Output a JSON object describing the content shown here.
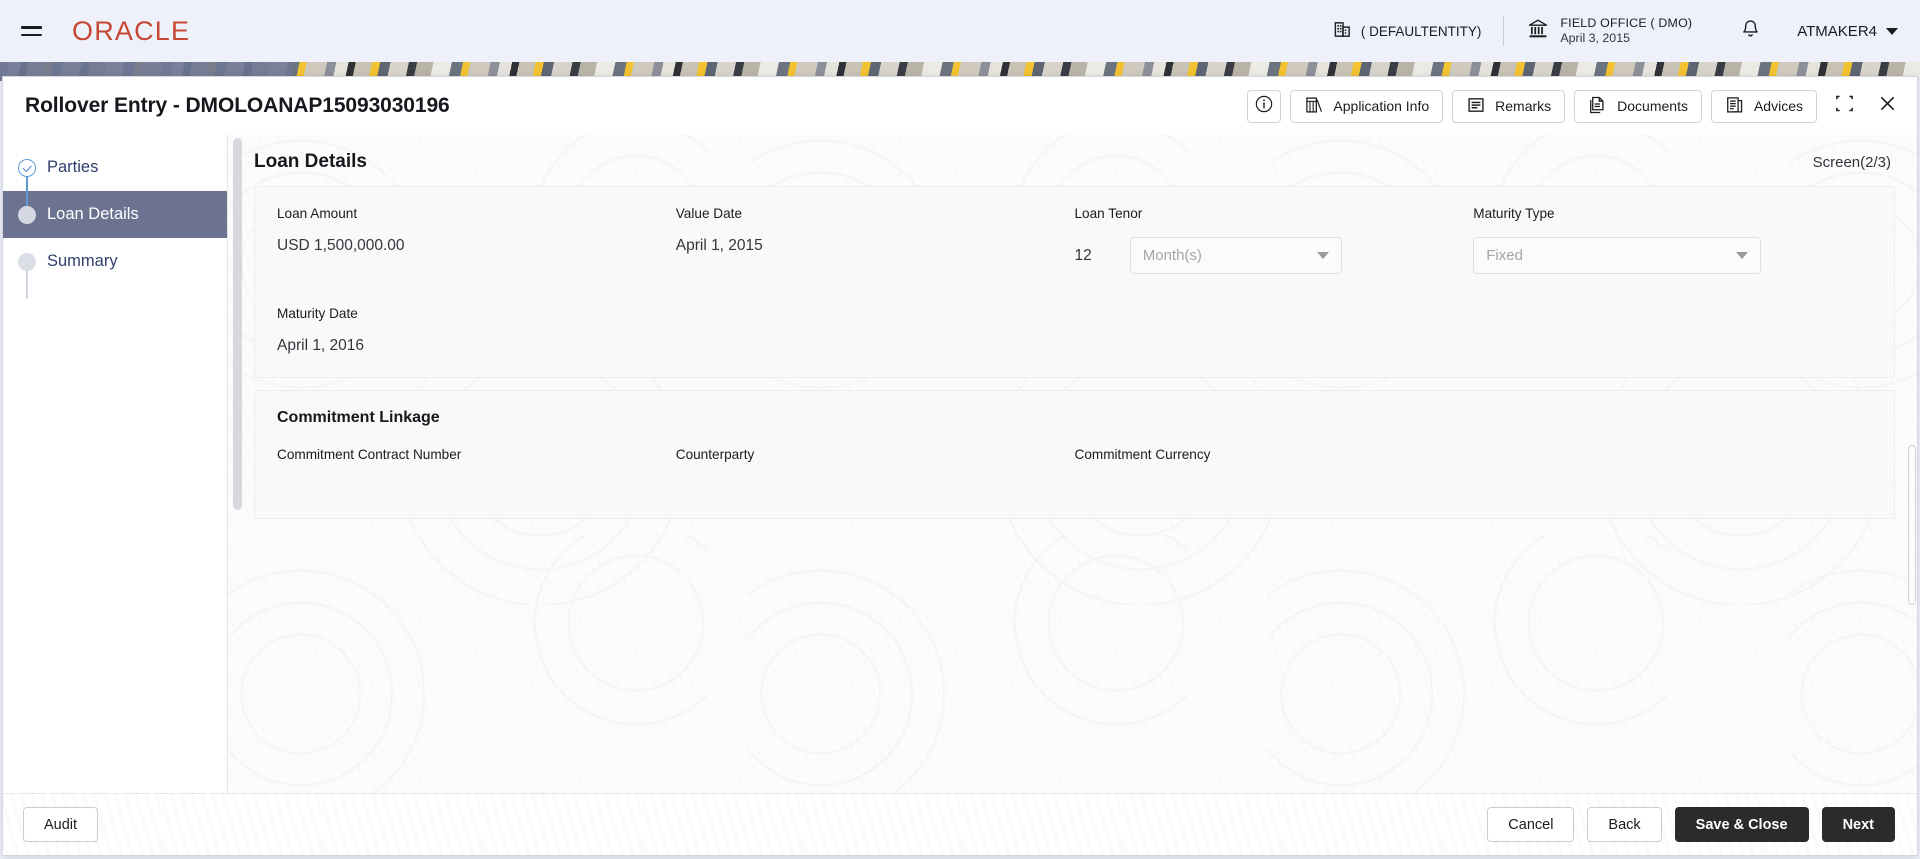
{
  "topbar": {
    "menu_icon": "hamburger-icon",
    "brand": "ORACLE",
    "entity": {
      "icon": "building-icon",
      "label": "( DEFAULTENTITY)"
    },
    "office": {
      "icon": "bank-icon",
      "name": "FIELD OFFICE ( DMO)",
      "date": "April 3, 2015"
    },
    "notification_icon": "bell-icon",
    "user": {
      "name": "ATMAKER4",
      "caret_icon": "chevron-down-icon"
    }
  },
  "modal": {
    "title": "Rollover Entry - DMOLOANAP15093030196",
    "actions": [
      {
        "icon": "info-circle-icon",
        "label": ""
      },
      {
        "icon": "application-info-icon",
        "label": "Application Info"
      },
      {
        "icon": "remarks-icon",
        "label": "Remarks"
      },
      {
        "icon": "documents-icon",
        "label": "Documents"
      },
      {
        "icon": "advices-icon",
        "label": "Advices"
      }
    ],
    "window_controls": [
      {
        "icon": "minimize-expand-icon"
      },
      {
        "icon": "close-icon"
      }
    ]
  },
  "stepper": {
    "items": [
      {
        "label": "Parties",
        "state": "done"
      },
      {
        "label": "Loan Details",
        "state": "current"
      },
      {
        "label": "Summary",
        "state": "todo"
      }
    ]
  },
  "content": {
    "section_title": "Loan Details",
    "screen_indicator": "Screen(2/3)",
    "fields": {
      "loan_amount": {
        "label": "Loan Amount",
        "value": "USD 1,500,000.00"
      },
      "value_date": {
        "label": "Value Date",
        "value": "April 1, 2015"
      },
      "loan_tenor": {
        "label": "Loan Tenor",
        "value": "12",
        "unit_placeholder": "Month(s)"
      },
      "maturity_type": {
        "label": "Maturity Type",
        "placeholder": "Fixed"
      },
      "maturity_date": {
        "label": "Maturity Date",
        "value": "April 1, 2016"
      }
    },
    "commitment_linkage": {
      "title": "Commitment Linkage",
      "labels": {
        "contract_number": "Commitment Contract Number",
        "counterparty": "Counterparty",
        "currency": "Commitment Currency"
      },
      "values": {
        "contract_number": "",
        "counterparty": "",
        "currency": ""
      }
    }
  },
  "footer": {
    "audit": "Audit",
    "cancel": "Cancel",
    "back": "Back",
    "save_close": "Save & Close",
    "next": "Next"
  },
  "colors": {
    "brand": "#c74634",
    "topbar_bg": "#eef1fa",
    "active_step_bg": "#6b7391",
    "step_text": "#2f3f6b",
    "primary_button": "#2b2b2b"
  }
}
